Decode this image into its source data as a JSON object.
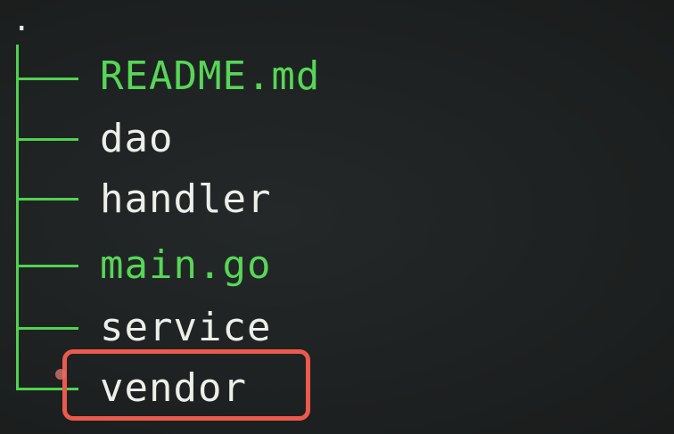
{
  "tree": {
    "root": ".",
    "entries": [
      {
        "name": "README.md",
        "kind": "file"
      },
      {
        "name": "dao",
        "kind": "dir"
      },
      {
        "name": "handler",
        "kind": "dir"
      },
      {
        "name": "main.go",
        "kind": "file"
      },
      {
        "name": "service",
        "kind": "dir"
      },
      {
        "name": "vendor",
        "kind": "dir",
        "highlighted": true
      }
    ]
  },
  "colors": {
    "background": "#1f2222",
    "tree_lines": "#4fd34f",
    "file_text": "#57d657",
    "dir_text": "#ecefe9",
    "highlight": "#ec5a4c"
  }
}
